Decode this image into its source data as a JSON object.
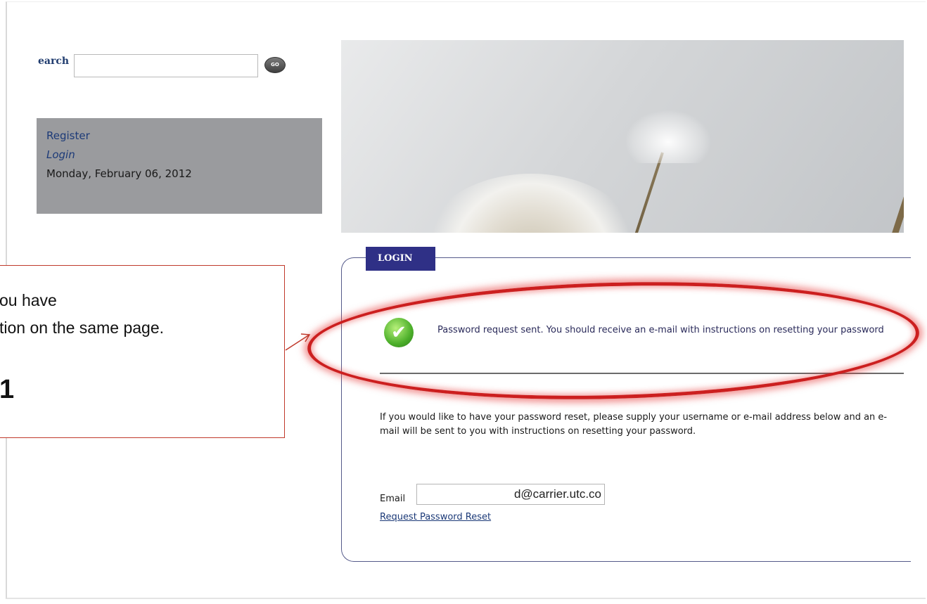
{
  "search": {
    "label": "earch",
    "value": "",
    "go_label": "GO"
  },
  "user_panel": {
    "register_label": "Register",
    "login_label": "Login",
    "date": "Monday, February 06, 2012"
  },
  "login": {
    "tab_label": "LOGIN",
    "success_message": "Password request sent. You should receive an e-mail with instructions on resetting your password",
    "instructions": "If you would like to have your password reset, please supply your username or e-mail address below and an e-mail will be sent to you with instructions on resetting your password.",
    "email_label": "Email",
    "email_value": "d@carrier.utc.co",
    "reset_link_label": "Request Password Reset"
  },
  "callout": {
    "line1": "ou have",
    "line2": "tion on the same page.",
    "big_text": "1"
  },
  "colors": {
    "tab_bg": "#2f3086",
    "highlight": "#cc1f1f",
    "link": "#1c3a78",
    "panel_bg": "#9a9b9e"
  }
}
